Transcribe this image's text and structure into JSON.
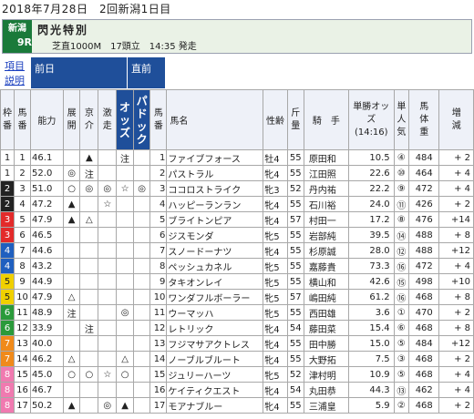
{
  "header": {
    "date": "2018年7月28日　2回新潟1日目"
  },
  "race": {
    "venue": "新潟",
    "number": "9R",
    "name": "閃光特別",
    "info": "芝直1000M　17頭立　14:35 発走"
  },
  "links": {
    "items": "項目",
    "explanation": "説明"
  },
  "groups": {
    "previous_day": "前日",
    "just_before": "直前"
  },
  "columns": {
    "frame": "枠番",
    "horse_no": "馬番",
    "ability": "能力",
    "development": "展開",
    "kyoto": "京介",
    "gekiso": "激走",
    "odds": "オッズ",
    "paddock": "パドック",
    "horse_no2": "馬番",
    "horse_name": "馬名",
    "sex_age": "性齢",
    "weight_carried": "斤量",
    "jockey": "騎　手",
    "win_odds": "単勝オッズ(14:16)",
    "popularity": "単人気",
    "body_weight": "馬体重",
    "weight_change": "増減"
  },
  "frame_colors": {
    "1": {
      "bg": "#ffffff",
      "fg": "#222222"
    },
    "2": {
      "bg": "#222222",
      "fg": "#ffffff"
    },
    "3": {
      "bg": "#e32a2a",
      "fg": "#ffffff"
    },
    "4": {
      "bg": "#1f5fbf",
      "fg": "#ffffff"
    },
    "5": {
      "bg": "#f0d000",
      "fg": "#222222"
    },
    "6": {
      "bg": "#2a9a3a",
      "fg": "#ffffff"
    },
    "7": {
      "bg": "#f08a1a",
      "fg": "#ffffff"
    },
    "8": {
      "bg": "#f07ab0",
      "fg": "#ffffff"
    }
  },
  "rows": [
    {
      "frame": "1",
      "no": "1",
      "ability": "46.1",
      "dev": "",
      "kyo": "▲",
      "geki": "",
      "odds": "注",
      "pad": "",
      "no2": "1",
      "name": "ファイブフォース",
      "sex": "牡4",
      "kin": "55",
      "jockey": "原田和",
      "win": "10.5",
      "pop": "④",
      "bw": "484",
      "chg": "+ 2"
    },
    {
      "frame": "1",
      "no": "2",
      "ability": "52.0",
      "dev": "◎",
      "kyo": "注",
      "geki": "",
      "odds": "",
      "pad": "",
      "no2": "2",
      "name": "パストラル",
      "sex": "牝4",
      "kin": "55",
      "jockey": "江田照",
      "win": "22.6",
      "pop": "⑩",
      "bw": "464",
      "chg": "+ 4"
    },
    {
      "frame": "2",
      "no": "3",
      "ability": "51.0",
      "dev": "○",
      "kyo": "◎",
      "geki": "◎",
      "odds": "☆",
      "pad": "◎",
      "no2": "3",
      "name": "ココロストライク",
      "sex": "牝3",
      "kin": "52",
      "jockey": "丹内祐",
      "win": "22.2",
      "pop": "⑨",
      "bw": "472",
      "chg": "+ 4"
    },
    {
      "frame": "2",
      "no": "4",
      "ability": "47.2",
      "dev": "▲",
      "kyo": "",
      "geki": "☆",
      "odds": "",
      "pad": "",
      "no2": "4",
      "name": "ハッピーランラン",
      "sex": "牝4",
      "kin": "55",
      "jockey": "石川裕",
      "win": "24.0",
      "pop": "⑪",
      "bw": "426",
      "chg": "+ 2"
    },
    {
      "frame": "3",
      "no": "5",
      "ability": "47.9",
      "dev": "▲",
      "kyo": "△",
      "geki": "",
      "odds": "",
      "pad": "",
      "no2": "5",
      "name": "ブライトンピア",
      "sex": "牝4",
      "kin": "57",
      "jockey": "村田一",
      "win": "17.2",
      "pop": "⑧",
      "bw": "476",
      "chg": "+14"
    },
    {
      "frame": "3",
      "no": "6",
      "ability": "46.5",
      "dev": "",
      "kyo": "",
      "geki": "",
      "odds": "",
      "pad": "",
      "no2": "6",
      "name": "ジスモンダ",
      "sex": "牝5",
      "kin": "55",
      "jockey": "岩部純",
      "win": "39.5",
      "pop": "⑭",
      "bw": "488",
      "chg": "+ 8"
    },
    {
      "frame": "4",
      "no": "7",
      "ability": "44.6",
      "dev": "",
      "kyo": "",
      "geki": "",
      "odds": "",
      "pad": "",
      "no2": "7",
      "name": "スノードーナツ",
      "sex": "牝4",
      "kin": "55",
      "jockey": "杉原誠",
      "win": "28.0",
      "pop": "⑫",
      "bw": "488",
      "chg": "+12"
    },
    {
      "frame": "4",
      "no": "8",
      "ability": "43.2",
      "dev": "",
      "kyo": "",
      "geki": "",
      "odds": "",
      "pad": "",
      "no2": "8",
      "name": "ペッシュカネル",
      "sex": "牝5",
      "kin": "55",
      "jockey": "嘉藤貴",
      "win": "73.3",
      "pop": "⑯",
      "bw": "472",
      "chg": "+ 4"
    },
    {
      "frame": "5",
      "no": "9",
      "ability": "44.9",
      "dev": "",
      "kyo": "",
      "geki": "",
      "odds": "",
      "pad": "",
      "no2": "9",
      "name": "タキオンレイ",
      "sex": "牝5",
      "kin": "55",
      "jockey": "横山和",
      "win": "42.6",
      "pop": "⑮",
      "bw": "498",
      "chg": "+10"
    },
    {
      "frame": "5",
      "no": "10",
      "ability": "47.9",
      "dev": "△",
      "kyo": "",
      "geki": "",
      "odds": "",
      "pad": "",
      "no2": "10",
      "name": "ワンダフルボーラー",
      "sex": "牝5",
      "kin": "57",
      "jockey": "嶋田純",
      "win": "61.2",
      "pop": "⑯",
      "bw": "468",
      "chg": "+ 8"
    },
    {
      "frame": "6",
      "no": "11",
      "ability": "48.9",
      "dev": "注",
      "kyo": "",
      "geki": "",
      "odds": "◎",
      "pad": "",
      "no2": "11",
      "name": "ウーマッハ",
      "sex": "牝5",
      "kin": "55",
      "jockey": "西田雄",
      "win": "3.6",
      "pop": "①",
      "bw": "470",
      "chg": "+ 2"
    },
    {
      "frame": "6",
      "no": "12",
      "ability": "33.9",
      "dev": "",
      "kyo": "注",
      "geki": "",
      "odds": "",
      "pad": "",
      "no2": "12",
      "name": "レトリック",
      "sex": "牝4",
      "kin": "54",
      "jockey": "藤田菜",
      "win": "15.4",
      "pop": "⑥",
      "bw": "468",
      "chg": "+ 8"
    },
    {
      "frame": "7",
      "no": "13",
      "ability": "40.0",
      "dev": "",
      "kyo": "",
      "geki": "",
      "odds": "",
      "pad": "",
      "no2": "13",
      "name": "フジマサアクトレス",
      "sex": "牝4",
      "kin": "55",
      "jockey": "田中勝",
      "win": "15.0",
      "pop": "⑤",
      "bw": "484",
      "chg": "+12"
    },
    {
      "frame": "7",
      "no": "14",
      "ability": "46.2",
      "dev": "△",
      "kyo": "",
      "geki": "",
      "odds": "△",
      "pad": "",
      "no2": "14",
      "name": "ノーブルブルート",
      "sex": "牝4",
      "kin": "55",
      "jockey": "大野拓",
      "win": "7.5",
      "pop": "③",
      "bw": "468",
      "chg": "+ 2"
    },
    {
      "frame": "8",
      "no": "15",
      "ability": "45.0",
      "dev": "○",
      "kyo": "○",
      "geki": "☆",
      "odds": "○",
      "pad": "",
      "no2": "15",
      "name": "ジュリーハーツ",
      "sex": "牝5",
      "kin": "52",
      "jockey": "津村明",
      "win": "10.9",
      "pop": "⑤",
      "bw": "468",
      "chg": "+ 4"
    },
    {
      "frame": "8",
      "no": "16",
      "ability": "46.7",
      "dev": "",
      "kyo": "",
      "geki": "",
      "odds": "",
      "pad": "",
      "no2": "16",
      "name": "ケイティクエスト",
      "sex": "牝4",
      "kin": "54",
      "jockey": "丸田恭",
      "win": "44.3",
      "pop": "⑬",
      "bw": "462",
      "chg": "+ 4"
    },
    {
      "frame": "8",
      "no": "17",
      "ability": "50.2",
      "dev": "▲",
      "kyo": "",
      "geki": "◎",
      "odds": "▲",
      "pad": "",
      "no2": "17",
      "name": "モアナブルー",
      "sex": "牝4",
      "kin": "55",
      "jockey": "三浦皇",
      "win": "5.9",
      "pop": "②",
      "bw": "468",
      "chg": "+ 2"
    }
  ]
}
